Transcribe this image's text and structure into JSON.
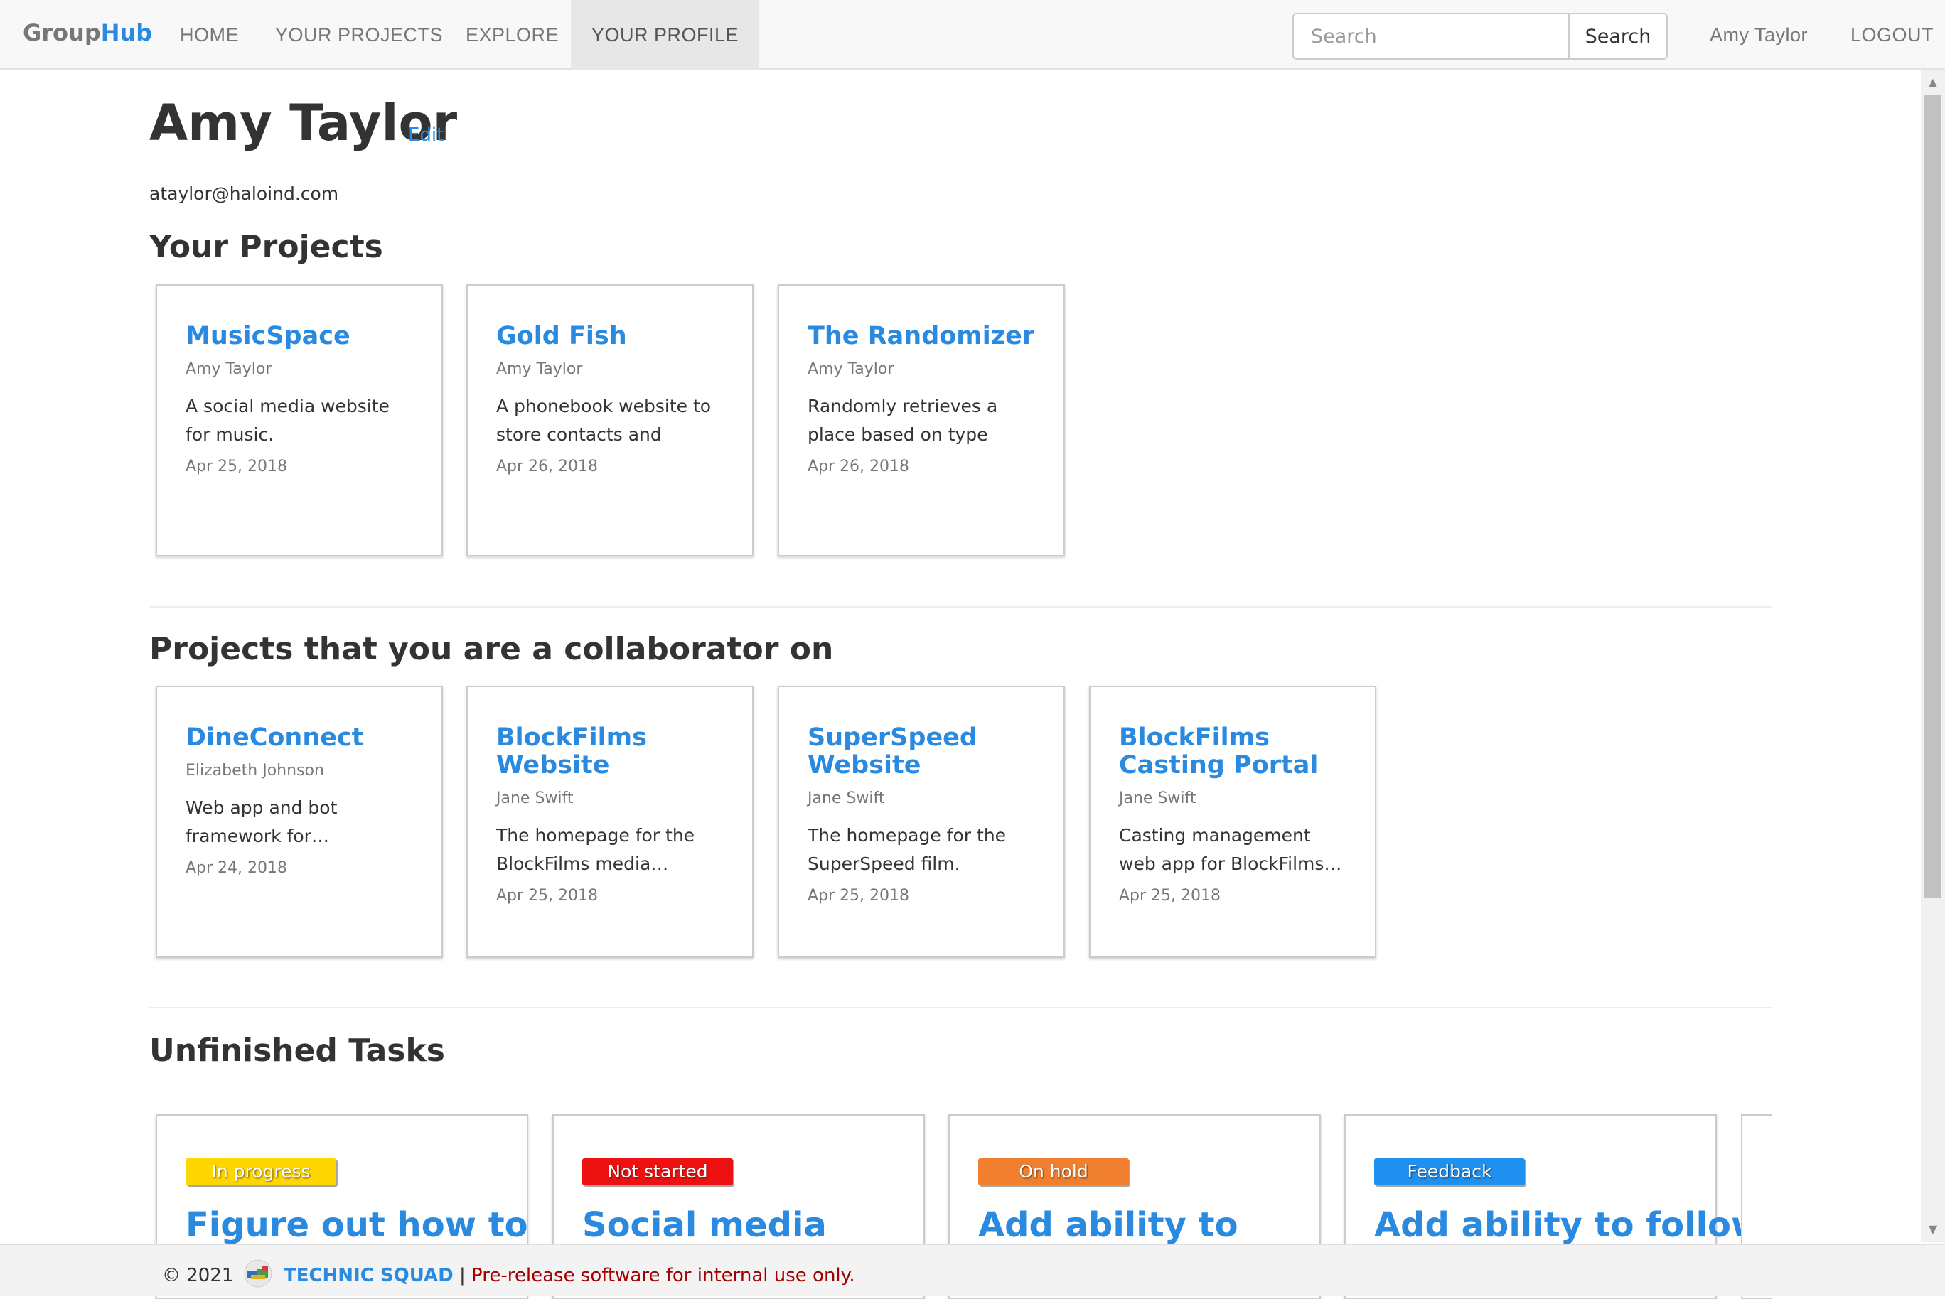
{
  "brand": {
    "part1": "Group",
    "part2": "Hub"
  },
  "nav": {
    "home": "HOME",
    "your_projects": "YOUR PROJECTS",
    "explore": "EXPLORE",
    "your_profile": "YOUR PROFILE",
    "user": "Amy Taylor",
    "logout": "LOGOUT"
  },
  "search": {
    "placeholder": "Search",
    "button": "Search"
  },
  "profile": {
    "name": "Amy Taylor",
    "edit": "Edit",
    "email": "ataylor@haloind.com"
  },
  "your_projects": {
    "title": "Your Projects",
    "items": [
      {
        "title": "MusicSpace",
        "owner": "Amy Taylor",
        "description": "A social media website for music.",
        "date": "Apr 25, 2018"
      },
      {
        "title": "Gold Fish",
        "owner": "Amy Taylor",
        "description": "A phonebook website to store contacts and send…",
        "date": "Apr 26, 2018"
      },
      {
        "title": "The Randomizer",
        "owner": "Amy Taylor",
        "description": "Randomly retrieves a place based on type and…",
        "date": "Apr 26, 2018"
      }
    ]
  },
  "collab_projects": {
    "title": "Projects that you are a collaborator on",
    "items": [
      {
        "title": "DineConnect",
        "owner": "Elizabeth Johnson",
        "description": "Web app and bot framework for…",
        "date": "Apr 24, 2018"
      },
      {
        "title": "BlockFilms Website",
        "owner": "Jane Swift",
        "description": "The homepage for the BlockFilms media…",
        "date": "Apr 25, 2018"
      },
      {
        "title": "SuperSpeed Website",
        "owner": "Jane Swift",
        "description": "The homepage for the SuperSpeed film.",
        "date": "Apr 25, 2018"
      },
      {
        "title": "BlockFilms Casting Portal",
        "owner": "Jane Swift",
        "description": "Casting management web app for BlockFilms…",
        "date": "Apr 25, 2018"
      }
    ]
  },
  "tasks": {
    "title": "Unfinished Tasks",
    "items": [
      {
        "status": "In progress",
        "status_color": "#ffd600",
        "title": "Figure out how to"
      },
      {
        "status": "Not started",
        "status_color": "#ee1111",
        "title": "Social media"
      },
      {
        "status": "On hold",
        "status_color": "#f08030",
        "title": "Add ability to"
      },
      {
        "status": "Feedback",
        "status_color": "#2090f0",
        "title": "Add ability to follow"
      }
    ]
  },
  "footer": {
    "copyright": "© 2021",
    "team": "TECHNIC SQUAD",
    "separator": "|",
    "notice": "Pre-release software for internal use only."
  },
  "colors": {
    "accent": "#2a8ae0",
    "notice": "#a00000"
  },
  "icons": {
    "logo": "technic-squad-logo-icon",
    "scroll_up": "scroll-up-arrow-icon",
    "scroll_down": "scroll-down-arrow-icon"
  }
}
